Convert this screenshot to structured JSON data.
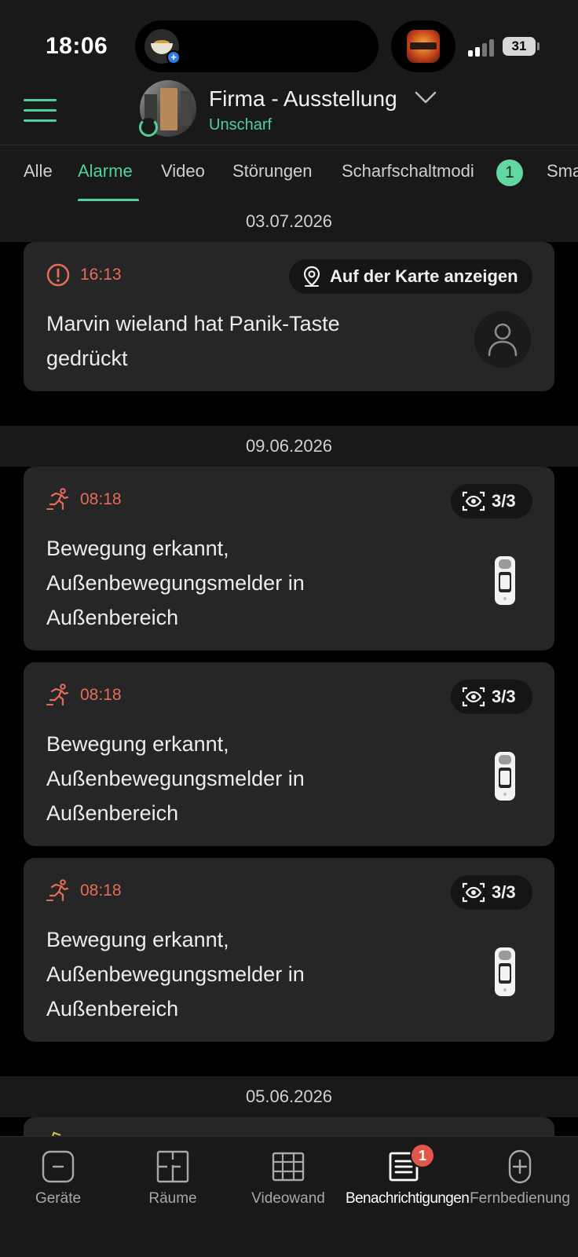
{
  "status_bar": {
    "time": "18:06",
    "battery": "31",
    "island_app_icon": "food-bowl-app-icon",
    "game_icon": "game-app-icon"
  },
  "header": {
    "hub_name": "Firma - Ausstellung",
    "hub_status": "Unscharf",
    "menu_icon": "hamburger-menu-icon"
  },
  "tabs": [
    {
      "label": "Alle",
      "active": false
    },
    {
      "label": "Alarme",
      "active": true
    },
    {
      "label": "Video",
      "active": false
    },
    {
      "label": "Störungen",
      "active": false
    },
    {
      "label": "Scharfschaltmodi",
      "active": false,
      "badge": "1"
    },
    {
      "label": "Sma",
      "active": false
    }
  ],
  "groups": [
    {
      "date": "03.07.2026",
      "events": [
        {
          "time": "16:13",
          "icon": "alert-circle-icon",
          "text_line1": "Marvin wieland hat Panik-Taste",
          "text_line2": "gedrückt",
          "action_label": "Auf der Karte anzeigen",
          "action_icon": "map-pin-icon",
          "thumb": "person-avatar-icon"
        }
      ]
    },
    {
      "date": "09.06.2026",
      "events": [
        {
          "time": "08:18",
          "icon": "motion-running-icon",
          "text_line1": "Bewegung erkannt,",
          "text_line2": "Außenbewegungsmelder in",
          "text_line3": "Außenbereich",
          "photo_count": "3/3",
          "photo_icon": "eye-scan-icon",
          "thumb": "outdoor-motion-detector-icon"
        },
        {
          "time": "08:18",
          "icon": "motion-running-icon",
          "text_line1": "Bewegung erkannt,",
          "text_line2": "Außenbewegungsmelder in",
          "text_line3": "Außenbereich",
          "photo_count": "3/3",
          "photo_icon": "eye-scan-icon",
          "thumb": "outdoor-motion-detector-icon"
        },
        {
          "time": "08:18",
          "icon": "motion-running-icon",
          "text_line1": "Bewegung erkannt,",
          "text_line2": "Außenbewegungsmelder in",
          "text_line3": "Außenbereich",
          "photo_count": "3/3",
          "photo_icon": "eye-scan-icon",
          "thumb": "outdoor-motion-detector-icon"
        }
      ]
    },
    {
      "date": "05.06.2026",
      "events": []
    }
  ],
  "bottom_nav": [
    {
      "label": "Geräte",
      "icon": "device-icon",
      "active": false
    },
    {
      "label": "Räume",
      "icon": "rooms-icon",
      "active": false
    },
    {
      "label": "Videowand",
      "icon": "video-wall-icon",
      "active": false
    },
    {
      "label": "Benachrichtigungen",
      "icon": "notifications-list-icon",
      "active": true,
      "badge": "1"
    },
    {
      "label": "Fernbedienung",
      "icon": "remote-control-icon",
      "active": false
    }
  ],
  "colors": {
    "accent": "#4fd19b",
    "alarm": "#e66b5b",
    "card": "#262626",
    "surface": "#191919",
    "background": "#000000"
  }
}
